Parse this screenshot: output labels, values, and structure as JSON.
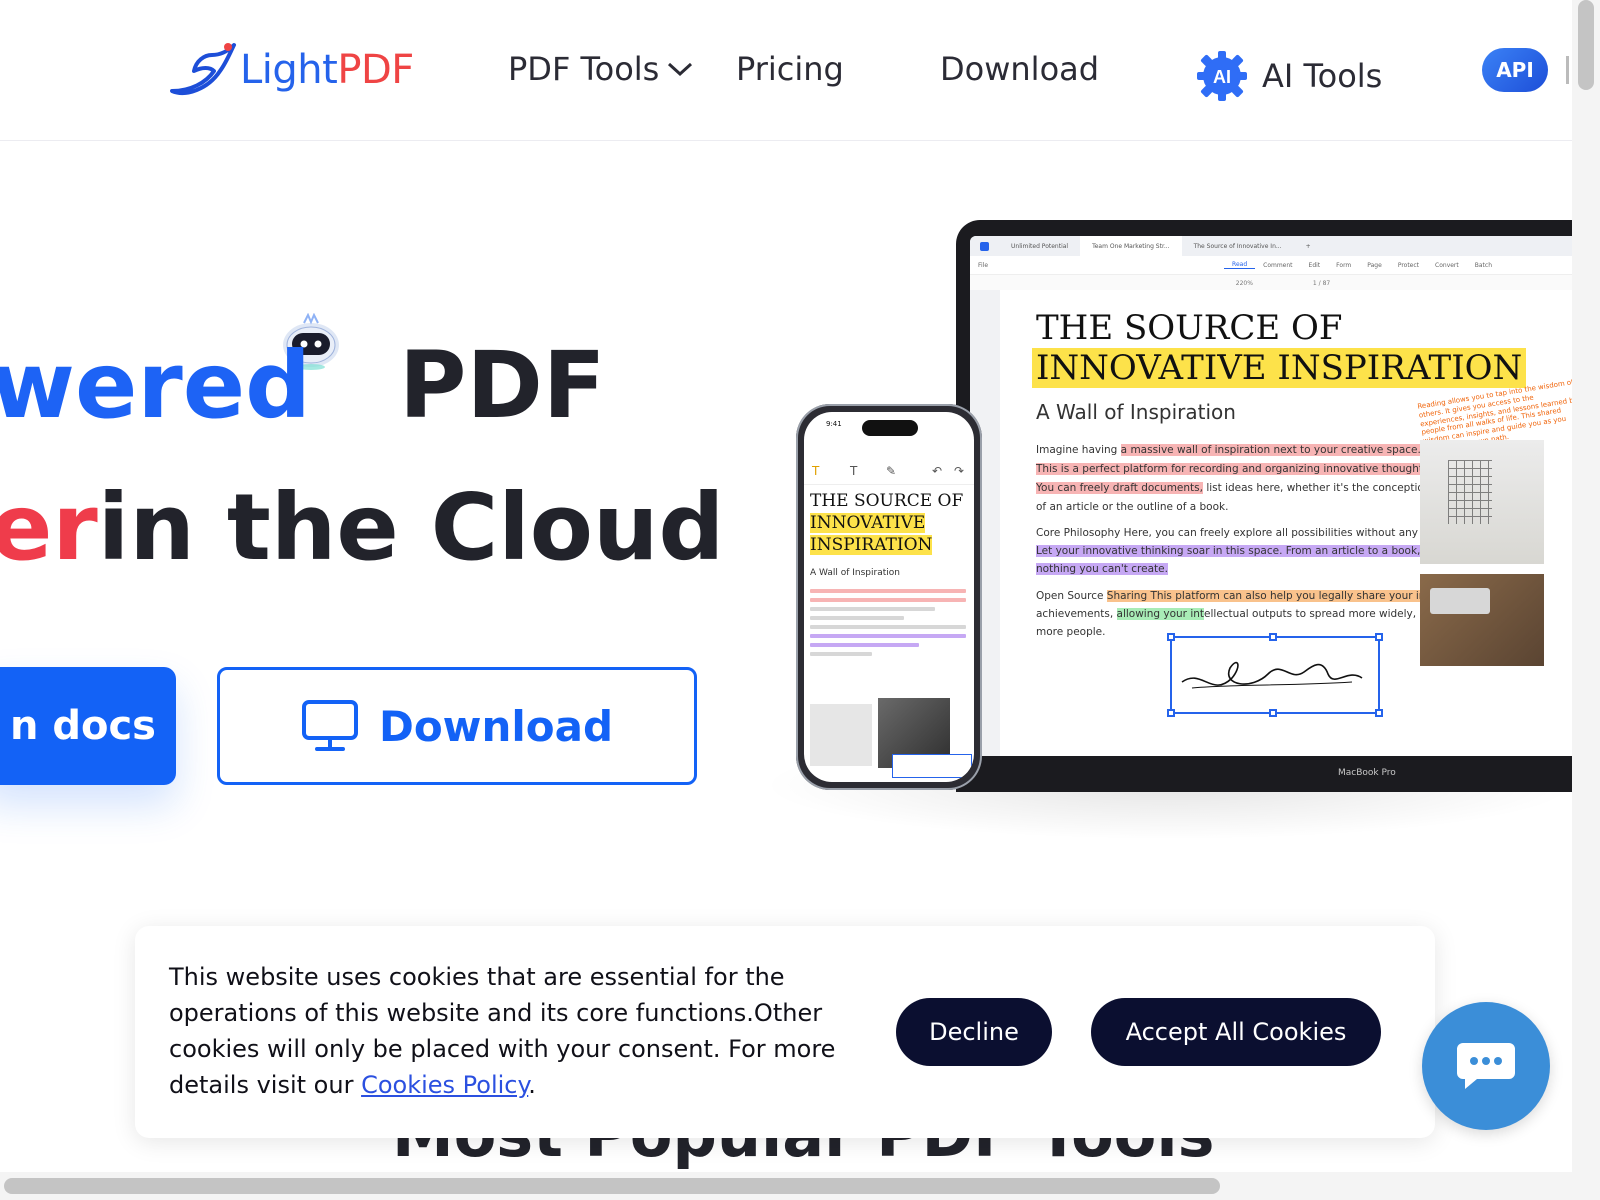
{
  "header": {
    "logo": {
      "light": "Light",
      "pdf": "PDF"
    },
    "nav": {
      "pdf_tools": "PDF Tools",
      "pricing": "Pricing",
      "download": "Download",
      "ai_badge": "AI",
      "ai_tools": "AI Tools",
      "api_badge": "API"
    }
  },
  "hero": {
    "line1_blue": "wered",
    "line1_dark": "PDF",
    "line2_red": "er",
    "line2_dark": "in the Cloud",
    "docs_button": "n docs",
    "download_button": "Download"
  },
  "mockup": {
    "tabs": [
      "Unlimited Potential",
      "Team One Marketing Str...",
      "The Source of Innovative In...",
      "+"
    ],
    "menus": [
      "File",
      "Read",
      "Comment",
      "Edit",
      "Form",
      "Page",
      "Protect",
      "Convert",
      "Batch"
    ],
    "zoom": "220%",
    "page_counter": "1 / 87",
    "doc_title_line1": "THE SOURCE OF",
    "doc_title_line2": "INNOVATIVE INSPIRATION",
    "doc_subtitle": "A Wall of Inspiration",
    "paragraph1": {
      "lead": "Imagine having ",
      "hl1": "a massive wall of inspiration next to your creative space.",
      "hl2": "This is a perfect platform for recording and organizing innovative thoughts.",
      "hl3": "You can freely draft documents,",
      "tail3": " list ideas here, whether it's the conception",
      "line4": "of an article or the outline of a book."
    },
    "paragraph2": {
      "line1": "Core Philosophy Here, you can freely explore all possibilities without any restrictions.",
      "hl1": "Let your innovative thinking soar in this space. From an article to a book, there's",
      "hl2": "nothing you can't create."
    },
    "paragraph3": {
      "lead": "Open Source ",
      "hl1": "Sharing This platform can also help you legally share your innovative",
      "line2a": "achievements, ",
      "hl2": "allowing your int",
      "line2b": "ellectual outputs to spread more widely, benefiting",
      "line3": "more people."
    },
    "orange_note": "Reading allows you to tap into the wisdom of others. It gives you access to the experiences, insights, and lessons learned by people from all walks of life. This shared wisdom can inspire and guide you as you navigate your own path.",
    "laptop_label": "MacBook Pro",
    "phone": {
      "time": "9:41",
      "title1": "THE SOURCE OF",
      "title2": "INNOVATIVE",
      "title3": "INSPIRATION",
      "subtitle": "A Wall of Inspiration"
    }
  },
  "section_title": "Most Popular PDF Tools",
  "cookie": {
    "text": "This website uses cookies that are essential for the operations of this website and its core functions.Other cookies will only be placed with your consent. For more details visit our ",
    "link": "Cookies Policy",
    "after_link": ".",
    "decline": "Decline",
    "accept": "Accept All Cookies"
  },
  "colors": {
    "brand_blue": "#1362f6",
    "brand_red": "#ef3c4b",
    "cookie_button": "#0b0f30",
    "chat_bubble": "#3b8ed8"
  }
}
